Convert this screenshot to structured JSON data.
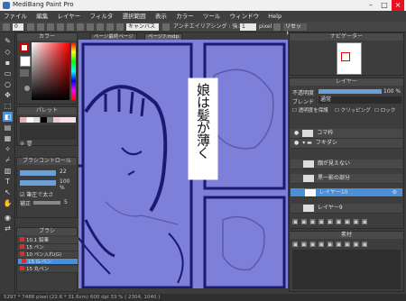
{
  "window": {
    "title": "MediBang Paint Pro"
  },
  "menu": [
    "ファイル(F)",
    "編集(E)",
    "レイヤー(L)",
    "フィルタ(I)",
    "選択範囲(S)",
    "表示(V)",
    "ウィンドウ(W)",
    "ヘルプ(H)"
  ],
  "menu_short": [
    "ファイル",
    "編集",
    "レイヤー",
    "フィルタ",
    "選択範囲",
    "表示",
    "カラー",
    "ツール",
    "ウィンドウ",
    "Help"
  ],
  "toolbar": {
    "brush_size": "0",
    "mode_select": "キャンバス",
    "antialias_label": "アンチエイリアシング : 強さ",
    "pixel_label": "pixel",
    "reset_label": "リセット"
  },
  "tabs": [
    "ページ最終ページ",
    "ページ7.mdp"
  ],
  "color_panel": {
    "title": "カラー"
  },
  "palette_panel": {
    "title": "パレット"
  },
  "brush_control": {
    "title": "ブラシコントロール",
    "size_value": "22",
    "opacity_value": "100 %",
    "pressure_label": "筆圧で太さ",
    "smooth_label": "補正",
    "smooth_value": "5"
  },
  "brush_panel": {
    "title": "ブラシ",
    "items": [
      {
        "num": "10.1",
        "name": "鉛筆"
      },
      {
        "num": "15",
        "name": "ペン"
      },
      {
        "num": "10",
        "name": "ペン入れ(G)"
      },
      {
        "num": "15",
        "name": "G-ペン"
      },
      {
        "num": "15",
        "name": "丸ペン"
      }
    ]
  },
  "navigator": {
    "title": "ナビゲーター"
  },
  "layer_panel": {
    "title": "レイヤー",
    "opacity_label": "不透明度",
    "opacity_value": "100 %",
    "blend_label": "ブレンド",
    "blend_value": "通常",
    "checks": [
      "透明度を保護",
      "クリッピング",
      "ロック"
    ],
    "layers": [
      "コマ枠",
      "フキダシ",
      "顔が見えない",
      "黒一影の部分",
      "レイヤー10",
      "レイヤー9"
    ]
  },
  "bottom_panel": {
    "title": "素材"
  },
  "canvas": {
    "speech_text": "娘は髪が薄く",
    "bg": "#7d7fd8",
    "line": "#1a1a6e"
  },
  "status": "5297 * 7488 pixel  (22.6 * 31.6cm)  600 dpi  33 %  ( 2304, 1040 )"
}
